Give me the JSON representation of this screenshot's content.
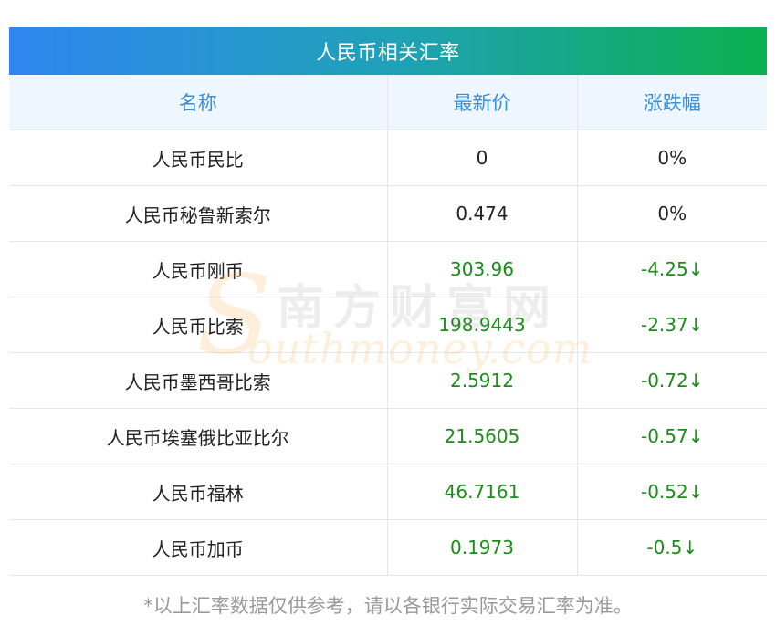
{
  "title": "人民币相关汇率",
  "headers": [
    "名称",
    "最新价",
    "涨跌幅"
  ],
  "rows": [
    {
      "name": "人民币民比",
      "price": "0",
      "change": "0%",
      "trend": "flat"
    },
    {
      "name": "人民币秘鲁新索尔",
      "price": "0.474",
      "change": "0%",
      "trend": "flat"
    },
    {
      "name": "人民币刚币",
      "price": "303.96",
      "change": "-4.25↓",
      "trend": "down"
    },
    {
      "name": "人民币比索",
      "price": "198.9443",
      "change": "-2.37↓",
      "trend": "down"
    },
    {
      "name": "人民币墨西哥比索",
      "price": "2.5912",
      "change": "-0.72↓",
      "trend": "down"
    },
    {
      "name": "人民币埃塞俄比亚比尔",
      "price": "21.5605",
      "change": "-0.57↓",
      "trend": "down"
    },
    {
      "name": "人民币福林",
      "price": "46.7161",
      "change": "-0.52↓",
      "trend": "down"
    },
    {
      "name": "人民币加币",
      "price": "0.1973",
      "change": "-0.5↓",
      "trend": "down"
    }
  ],
  "footnote": "*以上汇率数据仅供参考，请以各银行实际交易汇率为准。",
  "watermark": {
    "logo_letter": "S",
    "cn_text": "南方财富网",
    "en_text": "outhmoney.com"
  },
  "colors": {
    "title_gradient_start": "#2f86f0",
    "title_gradient_end": "#0bb04e",
    "header_text": "#3a8fd6",
    "header_bg": "#eef6ff",
    "down": "#1a8d1a",
    "flat": "#222222",
    "footnote": "#9a9a9a"
  }
}
